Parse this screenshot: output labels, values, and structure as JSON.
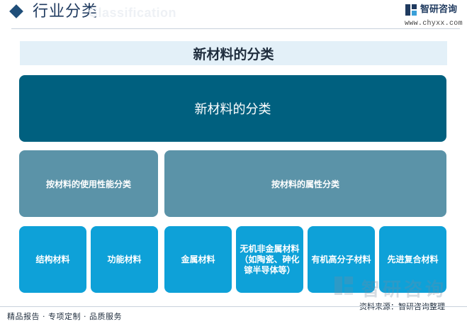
{
  "header": {
    "title": "行业分类",
    "subtitle_en": "Classification",
    "logo_name": "智研咨询",
    "logo_url": "www.chyxx.com"
  },
  "diagram": {
    "title": "新材料的分类",
    "root": "新材料的分类",
    "categories": [
      {
        "label": "按材料的使用性能分类"
      },
      {
        "label": "按材料的属性分类"
      }
    ],
    "leaves": [
      {
        "label": "结构材料"
      },
      {
        "label": "功能材料"
      },
      {
        "label": "金属材料"
      },
      {
        "label": "无机非金属材料（如陶瓷、砷化镓半导体等）"
      },
      {
        "label": "有机高分子材料"
      },
      {
        "label": "先进复合材料"
      }
    ]
  },
  "watermark": {
    "text": "智研咨询"
  },
  "footer": {
    "source": "资料来源：智研咨询整理",
    "tagline": "精品报告 · 专项定制 · 品质服务"
  },
  "colors": {
    "root": "#00607f",
    "category": "#5b93a8",
    "leaf": "#0ea1d8",
    "title_bar": "#e3f0f8"
  }
}
